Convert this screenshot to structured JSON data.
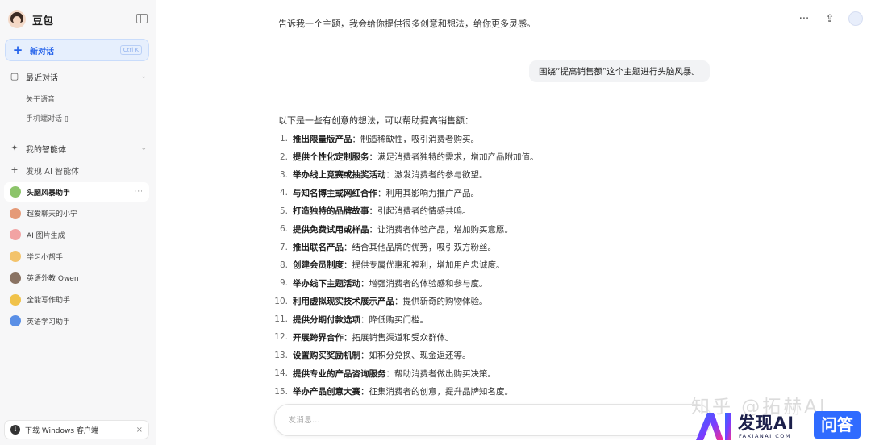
{
  "sidebar": {
    "app_name": "豆包",
    "new_chat": {
      "label": "新对话",
      "shortcut": "Ctrl K"
    },
    "recent": {
      "title": "最近对话",
      "items": [
        "关于语音",
        "手机端对话 ▯"
      ]
    },
    "agents": {
      "title": "我的智能体",
      "discover_label": "发现 AI 智能体",
      "items": [
        {
          "label": "头脑风暴助手",
          "active": true,
          "more": "···",
          "icon": "brainstorm-bot-icon",
          "color": "#8cc46a"
        },
        {
          "label": "超爱聊天的小宁",
          "active": false,
          "icon": "chat-girl-bot-icon",
          "color": "#e59a77"
        },
        {
          "label": "AI 图片生成",
          "active": false,
          "icon": "image-gen-bot-icon",
          "color": "#f2a3a3"
        },
        {
          "label": "学习小帮手",
          "active": false,
          "icon": "study-helper-bot-icon",
          "color": "#f3c36b"
        },
        {
          "label": "英语外教 Owen",
          "active": false,
          "icon": "english-tutor-bot-icon",
          "color": "#8a7363"
        },
        {
          "label": "全能写作助手",
          "active": false,
          "icon": "writing-bot-icon",
          "color": "#f0c24a"
        },
        {
          "label": "英语学习助手",
          "active": false,
          "icon": "english-study-bot-icon",
          "color": "#5a8fe6"
        }
      ]
    },
    "download": {
      "label": "下载 Windows 客户端",
      "close": "×"
    }
  },
  "chat": {
    "intro": "告诉我一个主题，我会给你提供很多创意和想法，给你更多灵感。",
    "user_message": "围绕“提高销售额”这个主题进行头脑风暴。",
    "answer_intro": "以下是一些有创意的想法，可以帮助提高销售额：",
    "ideas": [
      {
        "num": "1.",
        "title": "推出限量版产品",
        "desc": "：制造稀缺性，吸引消费者购买。"
      },
      {
        "num": "2.",
        "title": "提供个性化定制服务",
        "desc": "：满足消费者独特的需求，增加产品附加值。"
      },
      {
        "num": "3.",
        "title": "举办线上竞赛或抽奖活动",
        "desc": "：激发消费者的参与欲望。"
      },
      {
        "num": "4.",
        "title": "与知名博主或网红合作",
        "desc": "：利用其影响力推广产品。"
      },
      {
        "num": "5.",
        "title": "打造独特的品牌故事",
        "desc": "：引起消费者的情感共鸣。"
      },
      {
        "num": "6.",
        "title": "提供免费试用或样品",
        "desc": "：让消费者体验产品，增加购买意愿。"
      },
      {
        "num": "7.",
        "title": "推出联名产品",
        "desc": "：结合其他品牌的优势，吸引双方粉丝。"
      },
      {
        "num": "8.",
        "title": "创建会员制度",
        "desc": "：提供专属优惠和福利，增加用户忠诚度。"
      },
      {
        "num": "9.",
        "title": "举办线下主题活动",
        "desc": "：增强消费者的体验感和参与度。"
      },
      {
        "num": "10.",
        "title": "利用虚拟现实技术展示产品",
        "desc": "：提供新奇的购物体验。"
      },
      {
        "num": "11.",
        "title": "提供分期付款选项",
        "desc": "：降低购买门槛。"
      },
      {
        "num": "12.",
        "title": "开展跨界合作",
        "desc": "：拓展销售渠道和受众群体。"
      },
      {
        "num": "13.",
        "title": "设置购买奖励机制",
        "desc": "：如积分兑换、现金返还等。"
      },
      {
        "num": "14.",
        "title": "提供专业的产品咨询服务",
        "desc": "：帮助消费者做出购买决策。"
      },
      {
        "num": "15.",
        "title": "举办产品创意大赛",
        "desc": "：征集消费者的创意，提升品牌知名度。"
      }
    ],
    "input_placeholder": "发消息..."
  },
  "topbar": {
    "more": "···",
    "share": "⇪"
  },
  "watermark": {
    "faint_text": "知乎 @拓赫AI",
    "brand_text": "发现AI",
    "brand_small": "FAXIANAI.COM",
    "badge_text": "问答"
  }
}
